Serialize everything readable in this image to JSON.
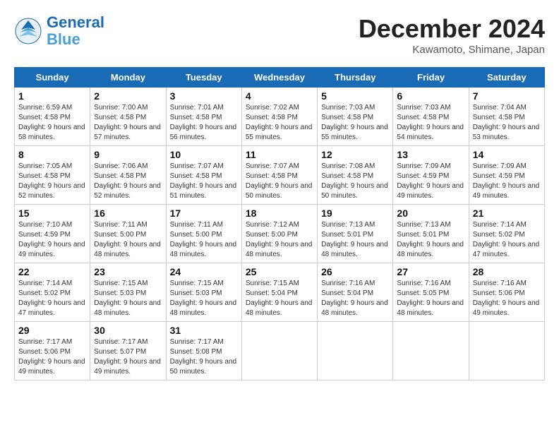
{
  "logo": {
    "line1": "General",
    "line2": "Blue"
  },
  "title": "December 2024",
  "location": "Kawamoto, Shimane, Japan",
  "weekdays": [
    "Sunday",
    "Monday",
    "Tuesday",
    "Wednesday",
    "Thursday",
    "Friday",
    "Saturday"
  ],
  "weeks": [
    [
      {
        "day": 1,
        "sunrise": "6:59 AM",
        "sunset": "4:58 PM",
        "daylight": "9 hours and 58 minutes."
      },
      {
        "day": 2,
        "sunrise": "7:00 AM",
        "sunset": "4:58 PM",
        "daylight": "9 hours and 57 minutes."
      },
      {
        "day": 3,
        "sunrise": "7:01 AM",
        "sunset": "4:58 PM",
        "daylight": "9 hours and 56 minutes."
      },
      {
        "day": 4,
        "sunrise": "7:02 AM",
        "sunset": "4:58 PM",
        "daylight": "9 hours and 55 minutes."
      },
      {
        "day": 5,
        "sunrise": "7:03 AM",
        "sunset": "4:58 PM",
        "daylight": "9 hours and 55 minutes."
      },
      {
        "day": 6,
        "sunrise": "7:03 AM",
        "sunset": "4:58 PM",
        "daylight": "9 hours and 54 minutes."
      },
      {
        "day": 7,
        "sunrise": "7:04 AM",
        "sunset": "4:58 PM",
        "daylight": "9 hours and 53 minutes."
      }
    ],
    [
      {
        "day": 8,
        "sunrise": "7:05 AM",
        "sunset": "4:58 PM",
        "daylight": "9 hours and 52 minutes."
      },
      {
        "day": 9,
        "sunrise": "7:06 AM",
        "sunset": "4:58 PM",
        "daylight": "9 hours and 52 minutes."
      },
      {
        "day": 10,
        "sunrise": "7:07 AM",
        "sunset": "4:58 PM",
        "daylight": "9 hours and 51 minutes."
      },
      {
        "day": 11,
        "sunrise": "7:07 AM",
        "sunset": "4:58 PM",
        "daylight": "9 hours and 50 minutes."
      },
      {
        "day": 12,
        "sunrise": "7:08 AM",
        "sunset": "4:58 PM",
        "daylight": "9 hours and 50 minutes."
      },
      {
        "day": 13,
        "sunrise": "7:09 AM",
        "sunset": "4:59 PM",
        "daylight": "9 hours and 49 minutes."
      },
      {
        "day": 14,
        "sunrise": "7:09 AM",
        "sunset": "4:59 PM",
        "daylight": "9 hours and 49 minutes."
      }
    ],
    [
      {
        "day": 15,
        "sunrise": "7:10 AM",
        "sunset": "4:59 PM",
        "daylight": "9 hours and 49 minutes."
      },
      {
        "day": 16,
        "sunrise": "7:11 AM",
        "sunset": "5:00 PM",
        "daylight": "9 hours and 48 minutes."
      },
      {
        "day": 17,
        "sunrise": "7:11 AM",
        "sunset": "5:00 PM",
        "daylight": "9 hours and 48 minutes."
      },
      {
        "day": 18,
        "sunrise": "7:12 AM",
        "sunset": "5:00 PM",
        "daylight": "9 hours and 48 minutes."
      },
      {
        "day": 19,
        "sunrise": "7:13 AM",
        "sunset": "5:01 PM",
        "daylight": "9 hours and 48 minutes."
      },
      {
        "day": 20,
        "sunrise": "7:13 AM",
        "sunset": "5:01 PM",
        "daylight": "9 hours and 48 minutes."
      },
      {
        "day": 21,
        "sunrise": "7:14 AM",
        "sunset": "5:02 PM",
        "daylight": "9 hours and 47 minutes."
      }
    ],
    [
      {
        "day": 22,
        "sunrise": "7:14 AM",
        "sunset": "5:02 PM",
        "daylight": "9 hours and 47 minutes."
      },
      {
        "day": 23,
        "sunrise": "7:15 AM",
        "sunset": "5:03 PM",
        "daylight": "9 hours and 48 minutes."
      },
      {
        "day": 24,
        "sunrise": "7:15 AM",
        "sunset": "5:03 PM",
        "daylight": "9 hours and 48 minutes."
      },
      {
        "day": 25,
        "sunrise": "7:15 AM",
        "sunset": "5:04 PM",
        "daylight": "9 hours and 48 minutes."
      },
      {
        "day": 26,
        "sunrise": "7:16 AM",
        "sunset": "5:04 PM",
        "daylight": "9 hours and 48 minutes."
      },
      {
        "day": 27,
        "sunrise": "7:16 AM",
        "sunset": "5:05 PM",
        "daylight": "9 hours and 48 minutes."
      },
      {
        "day": 28,
        "sunrise": "7:16 AM",
        "sunset": "5:06 PM",
        "daylight": "9 hours and 49 minutes."
      }
    ],
    [
      {
        "day": 29,
        "sunrise": "7:17 AM",
        "sunset": "5:06 PM",
        "daylight": "9 hours and 49 minutes."
      },
      {
        "day": 30,
        "sunrise": "7:17 AM",
        "sunset": "5:07 PM",
        "daylight": "9 hours and 49 minutes."
      },
      {
        "day": 31,
        "sunrise": "7:17 AM",
        "sunset": "5:08 PM",
        "daylight": "9 hours and 50 minutes."
      },
      null,
      null,
      null,
      null
    ]
  ]
}
